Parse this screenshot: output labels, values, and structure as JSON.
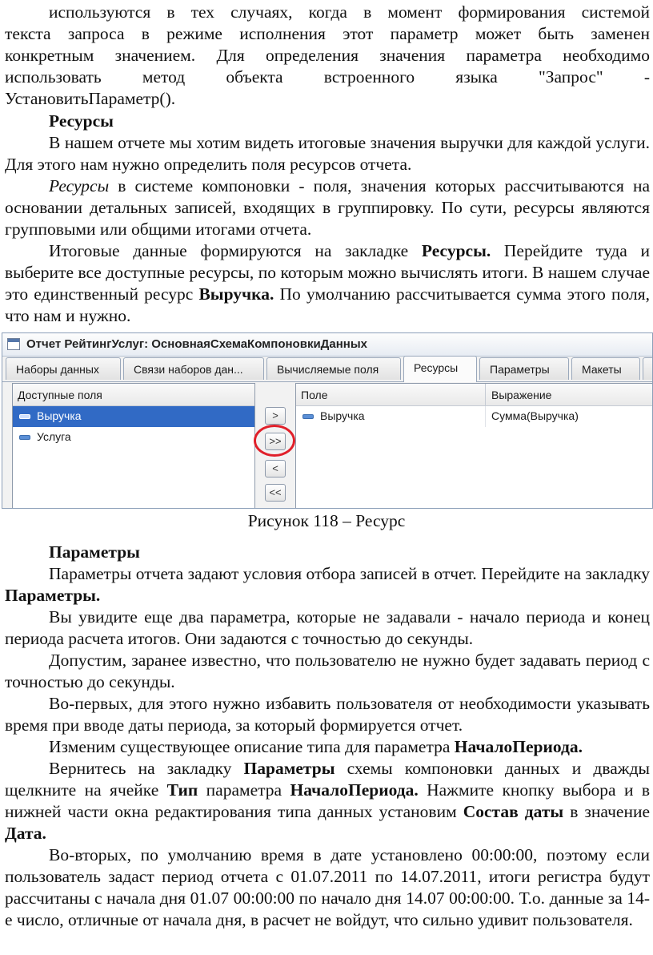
{
  "text": {
    "p1_l1": "используются в тех случаях, когда в момент формирования системой",
    "p1_l2": "текста запроса в режиме исполнения этот параметр может быть заменен",
    "p1_l3": "конкретным значением. Для определения значения параметра необходимо",
    "p1_l4": "использовать метод объекта встроенного языка \"Запрос\" -",
    "p1_l5": "УстановитьПараметр().",
    "h_resources": "Ресурсы",
    "p2": "В нашем отчете мы хотим видеть итоговые значения выручки для каждой услуги. Для этого нам нужно определить поля ресурсов отчета.",
    "p3_italic": "Ресурсы",
    "p3_rest": " в системе компоновки - поля, значения которых рассчитываются на основании детальных записей, входящих в группировку. По сути, ресурсы являются групповыми или общими итогами отчета.",
    "p4_a": "Итоговые данные формируются на закладке ",
    "p4_b": "Ресурсы.",
    "p4_c": " Перейдите туда и выберите все доступные ресурсы, по которым можно вычислять итоги. В нашем случае это единственный ресурс ",
    "p4_d": "Выручка.",
    "p4_e": " По умолчанию рассчитывается сумма этого поля, что нам и нужно.",
    "caption": "Рисунок 118 – Ресурс",
    "h_params": "Параметры",
    "p5_a": "Параметры отчета задают условия отбора записей в отчет. Перейдите на закладку ",
    "p5_b": "Параметры.",
    "p6": "Вы увидите еще два параметра, которые не задавали - начало периода и конец периода расчета итогов. Они задаются с точностью до секунды.",
    "p7": "Допустим, заранее известно, что пользователю не нужно будет задавать период с точностью до секунды.",
    "p8": "Во-первых, для этого нужно избавить пользователя от необходимости указывать время при вводе даты периода, за который формируется отчет.",
    "p9_a": "Изменим существующее описание типа для параметра ",
    "p9_b": "НачалоПериода.",
    "p10_a": "Вернитесь на закладку ",
    "p10_b": "Параметры",
    "p10_c": " схемы компоновки данных и дважды щелкните на ячейке ",
    "p10_d": "Тип",
    "p10_e": " параметра ",
    "p10_f": "НачалоПериода.",
    "p10_g": " Нажмите кнопку выбора и в нижней части окна редактирования типа данных установим ",
    "p10_h": "Состав даты",
    "p10_i": " в значение ",
    "p10_j": "Дата.",
    "p11": "Во-вторых, по умолчанию время в дате установлено 00:00:00, поэтому если пользователь задаст период отчета с 01.07.2011 по 14.07.2011, итоги регистра будут рассчитаны с начала дня 01.07 00:00:00 по начало дня 14.07 00:00:00. Т.о. данные за 14-е число, отличные от начала дня, в расчет не войдут, что сильно удивит пользователя."
  },
  "screenshot": {
    "window_title": "Отчет РейтингУслуг: ОсновнаяСхемаКомпоновкиДанных",
    "tabs": [
      {
        "label": "Наборы данных",
        "active": false
      },
      {
        "label": "Связи наборов дан...",
        "active": false
      },
      {
        "label": "Вычисляемые поля",
        "active": false
      },
      {
        "label": "Ресурсы",
        "active": true
      },
      {
        "label": "Параметры",
        "active": false
      },
      {
        "label": "Макеты",
        "active": false
      }
    ],
    "available": {
      "header": "Доступные поля",
      "items": [
        "Выручка",
        "Услуга"
      ]
    },
    "buttons": {
      "add": ">",
      "add_all": ">>",
      "remove": "<",
      "remove_all": "<<"
    },
    "resources": {
      "col_field": "Поле",
      "col_expr": "Выражение",
      "rows": [
        {
          "field": "Выручка",
          "expr": "Сумма(Выручка)"
        }
      ]
    },
    "highlight_color": "#e0202a",
    "selection_color": "#316ac5"
  }
}
